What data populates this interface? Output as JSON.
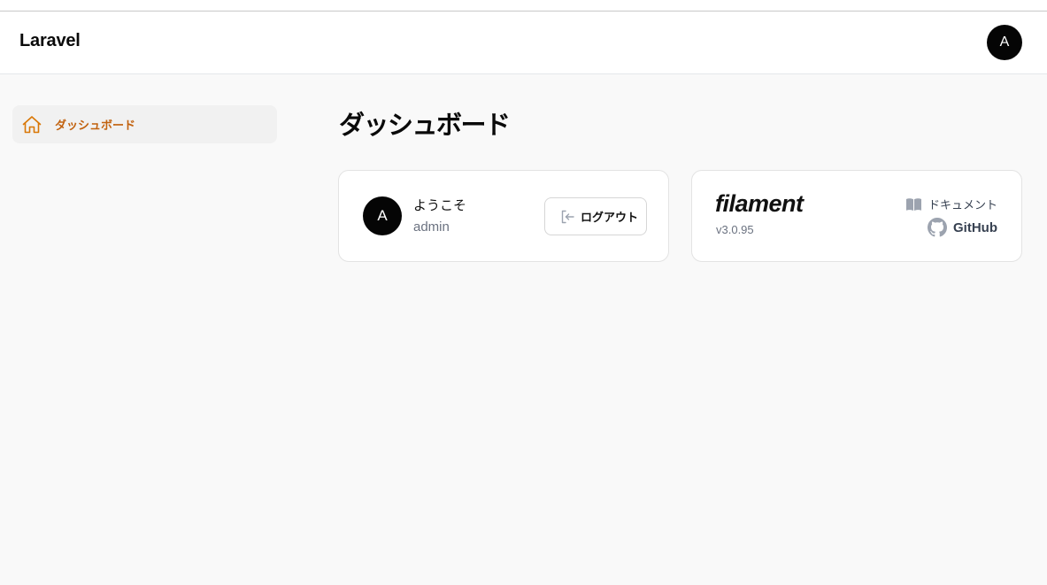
{
  "app": {
    "brand": "Laravel",
    "user_initial": "A"
  },
  "sidebar": {
    "items": [
      {
        "label": "ダッシュボード",
        "icon": "home-icon",
        "active": true
      }
    ]
  },
  "main": {
    "title": "ダッシュボード",
    "welcome_card": {
      "avatar_initial": "A",
      "greeting": "ようこそ",
      "username": "admin",
      "logout_label": "ログアウト"
    },
    "filament_card": {
      "logo_text": "filament",
      "version": "v3.0.95",
      "docs_label": "ドキュメント",
      "github_label": "GitHub"
    }
  },
  "colors": {
    "accent": "#c2620f",
    "background": "#f9f9f9",
    "avatar_bg": "#050505"
  }
}
